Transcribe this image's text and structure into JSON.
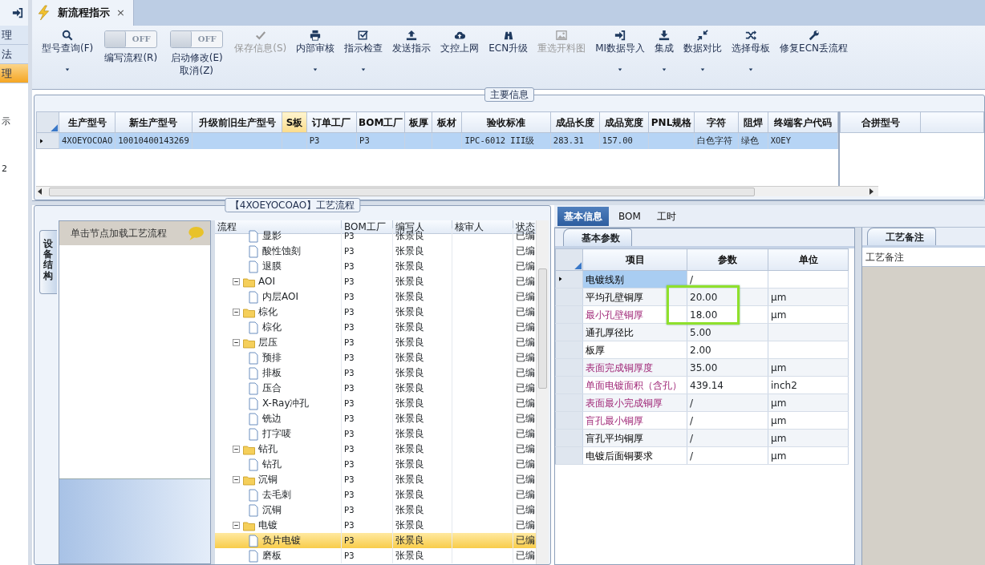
{
  "sidebar": {
    "items": [
      {
        "label": "理",
        "selected": false
      },
      {
        "label": "法",
        "selected": false
      },
      {
        "label": "理",
        "selected": true
      }
    ],
    "notes": [
      "示",
      "2"
    ]
  },
  "document_tab": {
    "title": "新流程指示",
    "close": "×"
  },
  "toolbar": [
    {
      "kind": "button",
      "label": "型号查询(F)",
      "dropdown": true,
      "disabled": false
    },
    {
      "kind": "toggle",
      "switch_text": "OFF",
      "on": false,
      "label": "编写流程(R)"
    },
    {
      "kind": "toggle",
      "switch_text": "OFF",
      "on": false,
      "label": "启动修改(E)",
      "label_2": "取消(Z)"
    },
    {
      "kind": "button",
      "label": "保存信息(S)",
      "dropdown": false,
      "disabled": true
    },
    {
      "kind": "button",
      "label": "内部审核",
      "dropdown": true,
      "disabled": false
    },
    {
      "kind": "button",
      "label": "指示检查",
      "dropdown": true,
      "disabled": false
    },
    {
      "kind": "button",
      "label": "发送指示",
      "dropdown": false,
      "disabled": false
    },
    {
      "kind": "button",
      "label": "文控上网",
      "dropdown": false,
      "disabled": false
    },
    {
      "kind": "button",
      "label": "ECN升级",
      "dropdown": false,
      "disabled": false
    },
    {
      "kind": "button",
      "label": "重选开料图",
      "dropdown": false,
      "disabled": true
    },
    {
      "kind": "button",
      "label": "MI数据导入",
      "dropdown": true,
      "disabled": false
    },
    {
      "kind": "button",
      "label": "集成",
      "dropdown": true,
      "disabled": false
    },
    {
      "kind": "button",
      "label": "数据对比",
      "dropdown": true,
      "disabled": false
    },
    {
      "kind": "button",
      "label": "选择母板",
      "dropdown": true,
      "disabled": false
    },
    {
      "kind": "button",
      "label": "修复ECN丢流程",
      "dropdown": false,
      "disabled": false
    }
  ],
  "main_info": {
    "title": "主要信息",
    "columns": [
      {
        "label": "生产型号",
        "highlighted": false
      },
      {
        "label": "新生产型号",
        "highlighted": false
      },
      {
        "label": "升级前旧生产型号",
        "highlighted": false
      },
      {
        "label": "S板",
        "highlighted": true
      },
      {
        "label": "订单工厂",
        "highlighted": false
      },
      {
        "label": "BOM工厂",
        "highlighted": false
      },
      {
        "label": "板厚",
        "highlighted": false
      },
      {
        "label": "板材",
        "highlighted": false
      },
      {
        "label": "验收标准",
        "highlighted": false
      },
      {
        "label": "成品长度",
        "highlighted": false
      },
      {
        "label": "成品宽度",
        "highlighted": false
      },
      {
        "label": "PNL规格",
        "highlighted": false
      },
      {
        "label": "字符",
        "highlighted": false
      },
      {
        "label": "阻焊",
        "highlighted": false
      },
      {
        "label": "终端客户代码",
        "highlighted": false
      }
    ],
    "rows": [
      {
        "selected": true,
        "cells": [
          "4XOEYOCOAO",
          "10010400143269",
          null,
          null,
          "P3",
          "P3",
          null,
          null,
          "IPC-6012 III级",
          "283.31",
          "157.00",
          null,
          "白色字符",
          "绿色",
          "XOEY"
        ]
      }
    ],
    "side_columns": [
      "合拼型号"
    ]
  },
  "process": {
    "title": "【4XOEYOCOAO】工艺流程",
    "side_tab": "设备结构",
    "hint": "单击节点加载工艺流程",
    "columns": [
      "流程",
      "BOM工厂",
      "编写人",
      "核审人",
      "状态"
    ],
    "tree": [
      {
        "kind": "file",
        "label": "显影",
        "bom": "P3",
        "writer": "张景良",
        "status": "已编",
        "selected": false
      },
      {
        "kind": "file",
        "label": "酸性蚀刻",
        "bom": "P3",
        "writer": "张景良",
        "status": "已编",
        "selected": false
      },
      {
        "kind": "file",
        "label": "退膜",
        "bom": "P3",
        "writer": "张景良",
        "status": "已编",
        "selected": false
      },
      {
        "kind": "folder",
        "label": "AOI",
        "bom": "P3",
        "writer": "张景良",
        "status": "已编",
        "selected": false,
        "expanded": true,
        "children": [
          {
            "kind": "file",
            "label": "内层AOI",
            "bom": "P3",
            "writer": "张景良",
            "status": "已编",
            "selected": false
          }
        ]
      },
      {
        "kind": "folder",
        "label": "棕化",
        "bom": "P3",
        "writer": "张景良",
        "status": "已编",
        "selected": false,
        "expanded": true,
        "children": [
          {
            "kind": "file",
            "label": "棕化",
            "bom": "P3",
            "writer": "张景良",
            "status": "已编",
            "selected": false
          }
        ]
      },
      {
        "kind": "folder",
        "label": "层压",
        "bom": "P3",
        "writer": "张景良",
        "status": "已编",
        "selected": false,
        "expanded": true,
        "children": [
          {
            "kind": "file",
            "label": "预排",
            "bom": "P3",
            "writer": "张景良",
            "status": "已编",
            "selected": false
          },
          {
            "kind": "file",
            "label": "排板",
            "bom": "P3",
            "writer": "张景良",
            "status": "已编",
            "selected": false
          },
          {
            "kind": "file",
            "label": "压合",
            "bom": "P3",
            "writer": "张景良",
            "status": "已编",
            "selected": false
          },
          {
            "kind": "file",
            "label": "X-Ray冲孔",
            "bom": "P3",
            "writer": "张景良",
            "status": "已编",
            "selected": false
          },
          {
            "kind": "file",
            "label": "铣边",
            "bom": "P3",
            "writer": "张景良",
            "status": "已编",
            "selected": false
          },
          {
            "kind": "file",
            "label": "打字唛",
            "bom": "P3",
            "writer": "张景良",
            "status": "已编",
            "selected": false
          }
        ]
      },
      {
        "kind": "folder",
        "label": "钻孔",
        "bom": "P3",
        "writer": "张景良",
        "status": "已编",
        "selected": false,
        "expanded": true,
        "children": [
          {
            "kind": "file",
            "label": "钻孔",
            "bom": "P3",
            "writer": "张景良",
            "status": "已编",
            "selected": false
          }
        ]
      },
      {
        "kind": "folder",
        "label": "沉铜",
        "bom": "P3",
        "writer": "张景良",
        "status": "已编",
        "selected": false,
        "expanded": true,
        "children": [
          {
            "kind": "file",
            "label": "去毛刺",
            "bom": "P3",
            "writer": "张景良",
            "status": "已编",
            "selected": false
          },
          {
            "kind": "file",
            "label": "沉铜",
            "bom": "P3",
            "writer": "张景良",
            "status": "已编",
            "selected": false
          }
        ]
      },
      {
        "kind": "folder",
        "label": "电镀",
        "bom": "P3",
        "writer": "张景良",
        "status": "已编",
        "selected": false,
        "expanded": true,
        "children": [
          {
            "kind": "file",
            "label": "负片电镀",
            "bom": "P3",
            "writer": "张景良",
            "status": "已编",
            "selected": true
          },
          {
            "kind": "file",
            "label": "磨板",
            "bom": "P3",
            "writer": "张景良",
            "status": "已编",
            "selected": false
          }
        ]
      }
    ]
  },
  "detail_tabs": [
    {
      "label": "基本信息",
      "selected": true
    },
    {
      "label": "BOM",
      "selected": false
    },
    {
      "label": "工时",
      "selected": false
    }
  ],
  "params": {
    "tab": "基本参数",
    "columns": [
      "项目",
      "参数",
      "单位"
    ],
    "rows": [
      {
        "item": "电镀线别",
        "value": "/",
        "emphasized": false,
        "selected": true,
        "highlighted": false
      },
      {
        "item": "平均孔壁铜厚",
        "value": "20.00",
        "unit": "μm",
        "emphasized": false,
        "selected": false,
        "highlighted": true
      },
      {
        "item": "最小孔壁铜厚",
        "value": "18.00",
        "unit": "μm",
        "emphasized": true,
        "selected": false,
        "highlighted": true
      },
      {
        "item": "通孔厚径比",
        "value": "5.00",
        "emphasized": false,
        "selected": false,
        "highlighted": false
      },
      {
        "item": "板厚",
        "value": "2.00",
        "emphasized": false,
        "selected": false,
        "highlighted": false
      },
      {
        "item": "表面完成铜厚度",
        "value": "35.00",
        "unit": "μm",
        "emphasized": true,
        "selected": false,
        "highlighted": false
      },
      {
        "item": "单面电镀面积（含孔）",
        "value": "439.14",
        "unit": "inch2",
        "emphasized": true,
        "selected": false,
        "highlighted": false
      },
      {
        "item": "表面最小完成铜厚",
        "value": "/",
        "unit": "μm",
        "emphasized": true,
        "selected": false,
        "highlighted": false
      },
      {
        "item": "盲孔最小铜厚",
        "value": "/",
        "unit": "μm",
        "emphasized": true,
        "selected": false,
        "highlighted": false
      },
      {
        "item": "盲孔平均铜厚",
        "value": "/",
        "unit": "μm",
        "emphasized": false,
        "selected": false,
        "highlighted": false
      },
      {
        "item": "电镀后面铜要求",
        "value": "/",
        "unit": "μm",
        "emphasized": false,
        "selected": false,
        "highlighted": false
      }
    ]
  },
  "notes": {
    "tab": "工艺备注",
    "header": "工艺备注"
  }
}
